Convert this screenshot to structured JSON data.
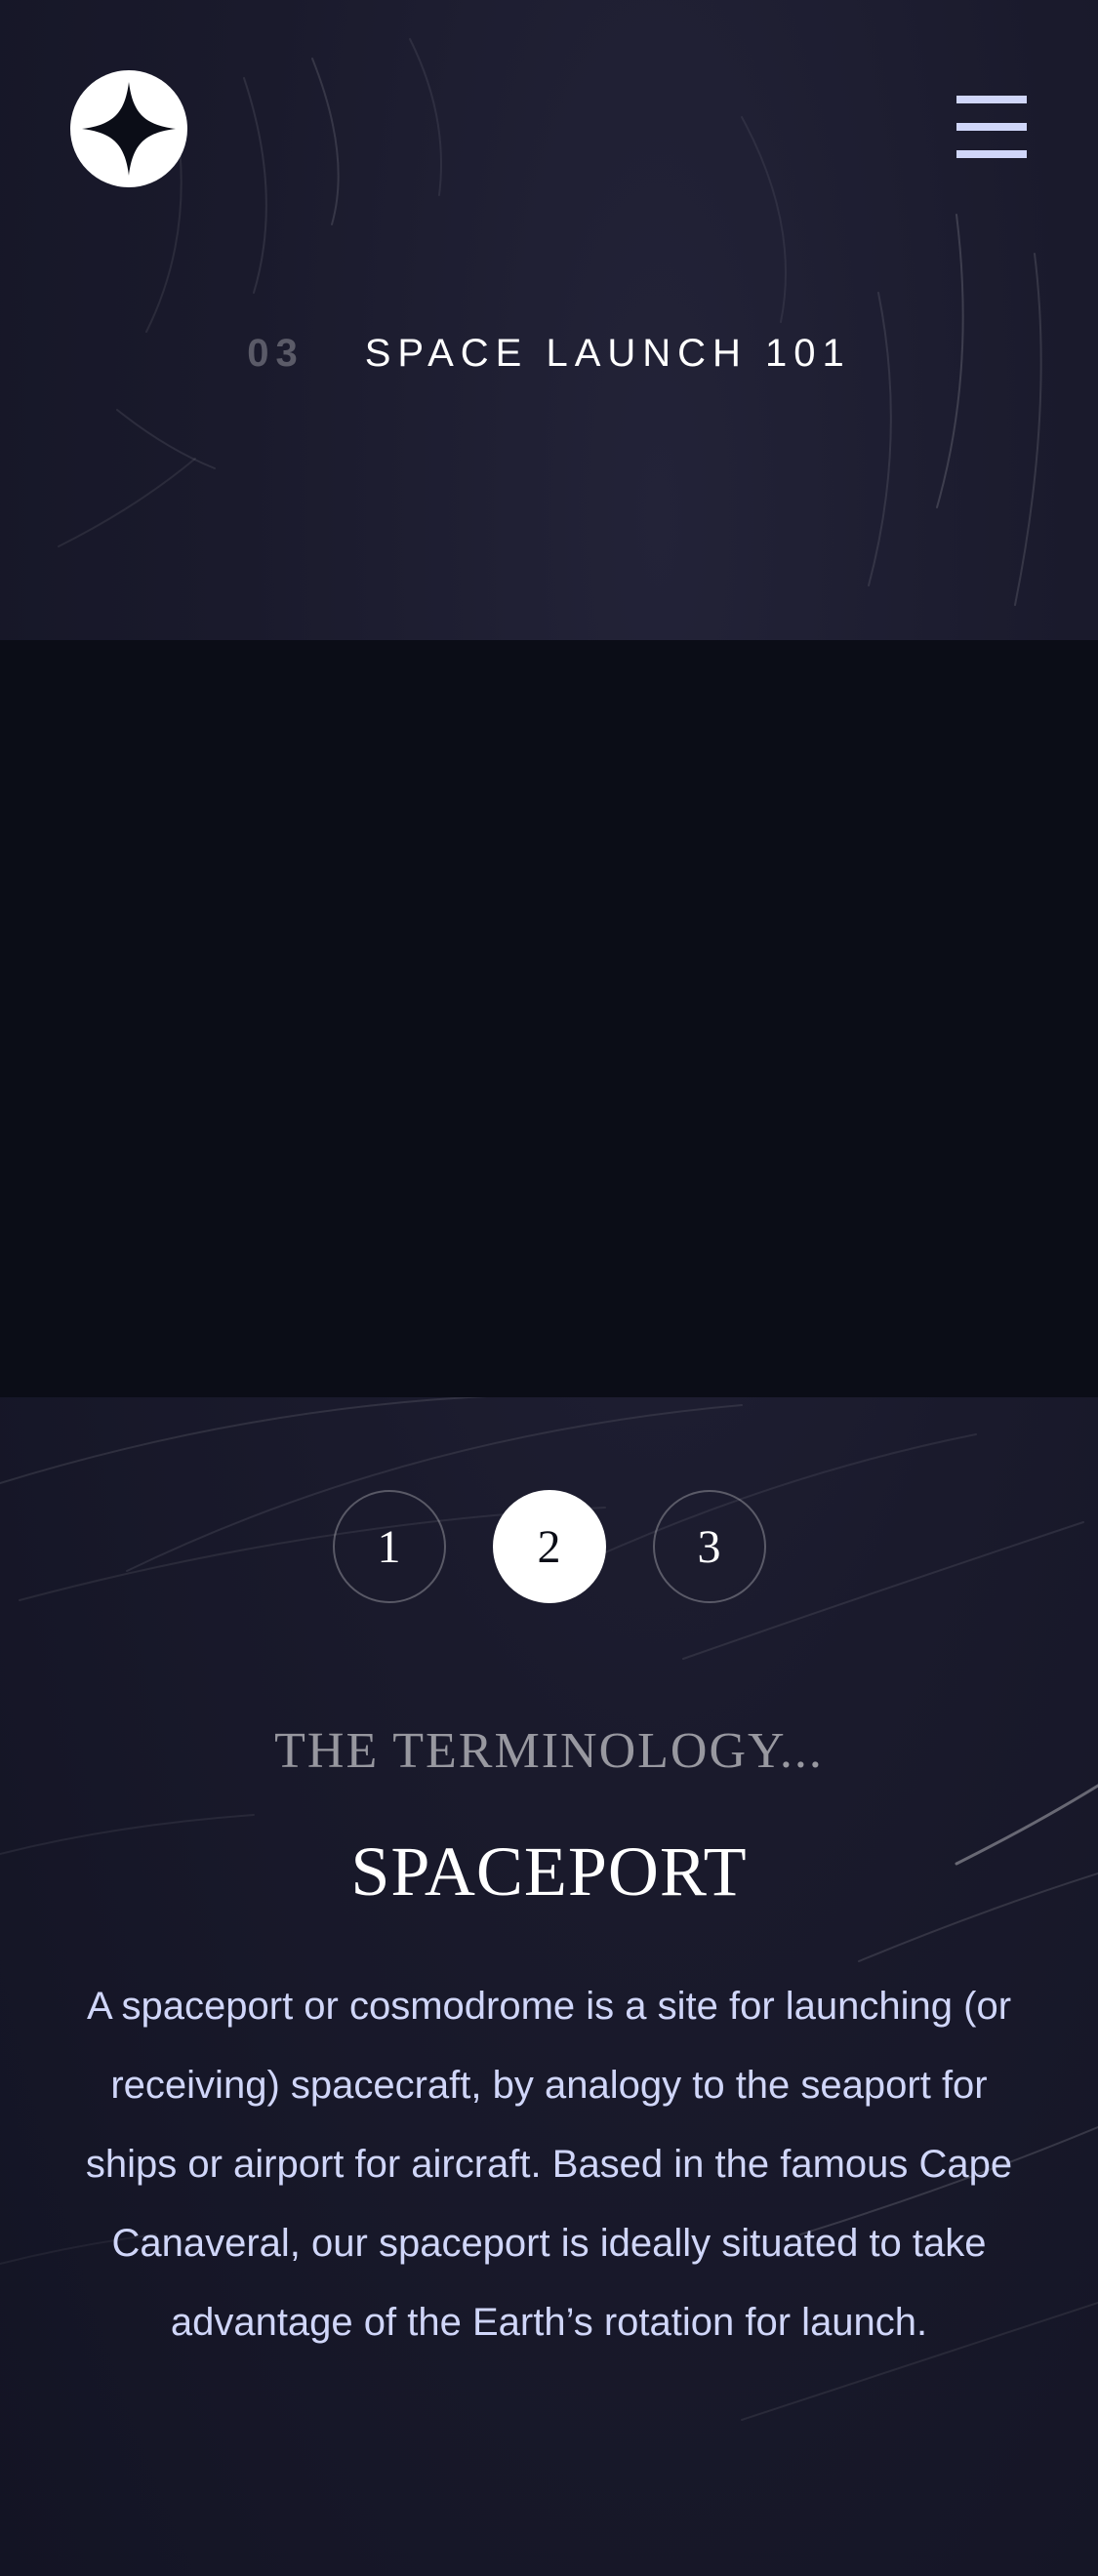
{
  "header": {
    "logo_icon": "four-point-star-icon",
    "menu_icon": "hamburger-menu-icon"
  },
  "page": {
    "number": "03",
    "title": "SPACE LAUNCH 101"
  },
  "pager": {
    "items": [
      "1",
      "2",
      "3"
    ],
    "active": "2"
  },
  "content": {
    "eyebrow": "THE TERMINOLOGY...",
    "term": "SPACEPORT",
    "description": "A spaceport or cosmodrome is a site for launching (or receiving) spacecraft, by analogy to the seaport for ships or airport for aircraft. Based in the famous Cape Canaveral, our spaceport is ideally situated to take advantage of the Earth’s rotation for launch."
  },
  "colors": {
    "background": "#161728",
    "image_area": "#0b0d17",
    "accent_text": "#d0d6f9",
    "white": "#ffffff"
  }
}
